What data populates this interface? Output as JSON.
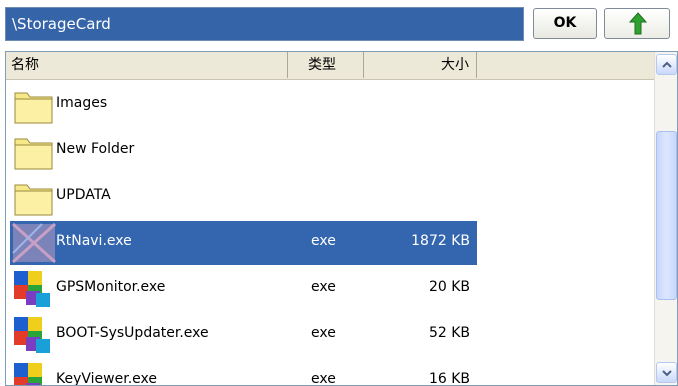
{
  "path": {
    "value": "\\StorageCard"
  },
  "toolbar": {
    "ok_label": "OK",
    "up_icon": "green-up-arrow-icon"
  },
  "columns": {
    "name": "名称",
    "type": "类型",
    "size": "大小"
  },
  "files": [
    {
      "name": "Images",
      "type": "",
      "size": "",
      "icon": "folder-icon",
      "selected": false
    },
    {
      "name": "New Folder",
      "type": "",
      "size": "",
      "icon": "folder-icon",
      "selected": false
    },
    {
      "name": "UPDATA",
      "type": "",
      "size": "",
      "icon": "folder-icon",
      "selected": false
    },
    {
      "name": "RtNavi.exe",
      "type": "exe",
      "size": "1872 KB",
      "icon": "rtnavi-app-icon",
      "selected": true
    },
    {
      "name": "GPSMonitor.exe",
      "type": "exe",
      "size": "20 KB",
      "icon": "exe-app-icon",
      "selected": false
    },
    {
      "name": "BOOT-SysUpdater.exe",
      "type": "exe",
      "size": "52 KB",
      "icon": "exe-app-icon",
      "selected": false
    },
    {
      "name": "KeyViewer.exe",
      "type": "exe",
      "size": "16 KB",
      "icon": "exe-app-icon",
      "selected": false
    }
  ],
  "colors": {
    "selection": "#3466b0",
    "path_bg": "#3565a8",
    "folder": "#f5e88a"
  }
}
